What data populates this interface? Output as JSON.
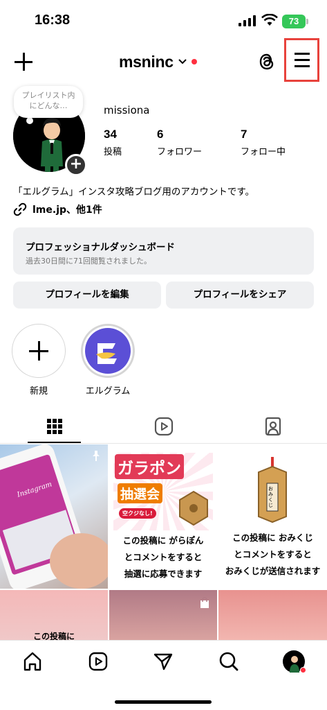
{
  "status_bar": {
    "time": "16:38",
    "battery": "73"
  },
  "header": {
    "username": "msninc"
  },
  "profile": {
    "note_bubble": "プレイリスト内にどんな…",
    "name": "missiona",
    "stats": [
      {
        "value": "34",
        "label": "投稿"
      },
      {
        "value": "6",
        "label": "フォロワー"
      },
      {
        "value": "7",
        "label": "フォロー中"
      }
    ],
    "bio": "「エルグラム」インスタ攻略ブログ用のアカウントです。",
    "link": "lme.jp、他1件"
  },
  "dashboard": {
    "title": "プロフェッショナルダッシュボード",
    "subtitle": "過去30日間に71回閲覧されました。"
  },
  "buttons": {
    "edit_profile": "プロフィールを編集",
    "share_profile": "プロフィールをシェア"
  },
  "highlights": [
    {
      "label": "新規"
    },
    {
      "label": "エルグラム"
    }
  ],
  "posts": {
    "post1": {
      "text": "Instagram"
    },
    "post2": {
      "title1": "ガラポン",
      "title2": "抽選会",
      "tag": "空クジなし!",
      "line1": "この投稿に がらぽん",
      "line2": "とコメントをすると",
      "line3": "抽選に応募できます"
    },
    "post3": {
      "box_label": "おみくじ",
      "line1": "この投稿に おみくじ",
      "line2": "とコメントをすると",
      "line3": "おみくじが送信されます"
    },
    "post4": {
      "text": "この投稿に"
    }
  },
  "colors": {
    "accent_red": "#ff3040",
    "highlight_box": "#e8423c",
    "battery": "#35c759"
  },
  "icons": [
    "plus-icon",
    "chevron-down-icon",
    "threads-icon",
    "menu-icon",
    "link-icon",
    "grid-icon",
    "reels-icon",
    "tagged-icon",
    "pin-icon",
    "shopping-bag-icon",
    "home-icon",
    "search-icon",
    "send-icon"
  ]
}
